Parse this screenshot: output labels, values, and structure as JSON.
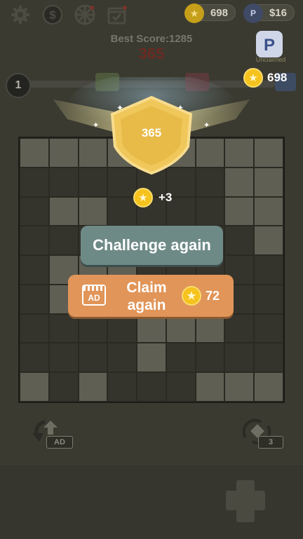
{
  "topbar": {
    "icons": [
      "gear-icon",
      "dollar-icon",
      "wheel-icon",
      "calendar-icon"
    ],
    "coins": "698",
    "cash": "$16"
  },
  "header": {
    "best_score": "Best Score:1285",
    "score": "365"
  },
  "paypal": {
    "label": "Unclaimed"
  },
  "progress": {
    "level": "1",
    "coins": "698"
  },
  "result": {
    "shield_score": "365",
    "reward": "+3",
    "challenge_label": "Challenge again",
    "claim_label_line1": "Claim",
    "claim_label_line2": "again",
    "ad_tag": "AD",
    "claim_cost": "72"
  },
  "tools": {
    "undo_tag": "AD",
    "rotate_count": "3"
  },
  "colors": {
    "accent_orange": "#e19559",
    "accent_teal": "#6e8a87",
    "gold": "#f6c21d",
    "score_red": "#6b2a22"
  },
  "board": {
    "cols": 9,
    "rows": 9,
    "light_cells": [
      [
        0,
        0
      ],
      [
        1,
        0
      ],
      [
        2,
        0
      ],
      [
        3,
        0
      ],
      [
        4,
        0
      ],
      [
        5,
        0
      ],
      [
        6,
        0
      ],
      [
        7,
        0
      ],
      [
        8,
        0
      ],
      [
        7,
        1
      ],
      [
        8,
        1
      ],
      [
        1,
        2
      ],
      [
        2,
        2
      ],
      [
        7,
        2
      ],
      [
        8,
        2
      ],
      [
        8,
        3
      ],
      [
        1,
        4
      ],
      [
        2,
        4
      ],
      [
        3,
        4
      ],
      [
        1,
        5
      ],
      [
        2,
        5
      ],
      [
        3,
        5
      ],
      [
        5,
        5
      ],
      [
        6,
        5
      ],
      [
        4,
        6
      ],
      [
        5,
        6
      ],
      [
        6,
        6
      ],
      [
        4,
        7
      ],
      [
        0,
        8
      ],
      [
        2,
        8
      ],
      [
        6,
        8
      ],
      [
        7,
        8
      ],
      [
        8,
        8
      ]
    ]
  }
}
